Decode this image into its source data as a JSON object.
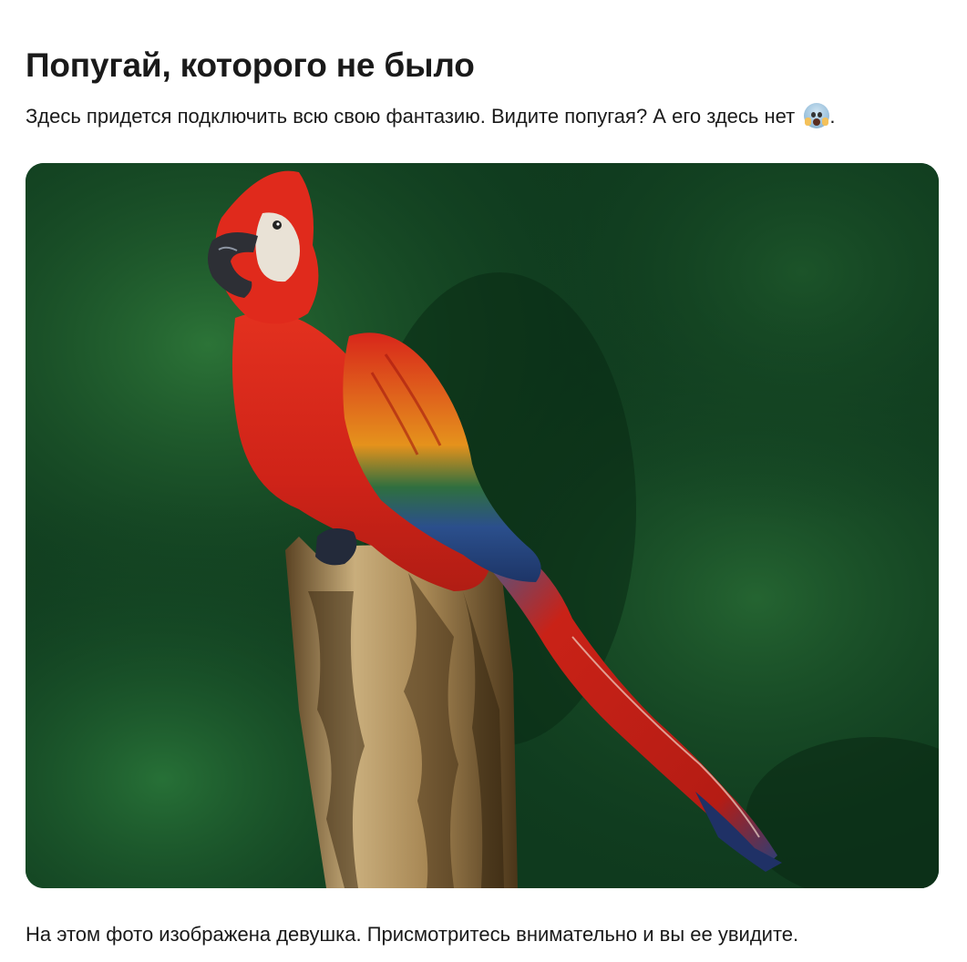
{
  "article": {
    "title": "Попугай, которого не было",
    "intro_text": "Здесь придется подключить всю свою фантазию. Видите попугая? А его здесь нет",
    "intro_emoji": "face-screaming-in-fear",
    "intro_end": ".",
    "caption": "На этом фото изображена девушка. Присмотритесь внимательно и вы ее увидите."
  },
  "photo": {
    "subject": "body-painted-parrot-on-stump",
    "colors": {
      "background": "#0f3a1e",
      "parrot_red": "#d8261b",
      "parrot_blue": "#2f4f8a",
      "parrot_yellow": "#e9a11d",
      "stump": "#b89d6a"
    }
  }
}
